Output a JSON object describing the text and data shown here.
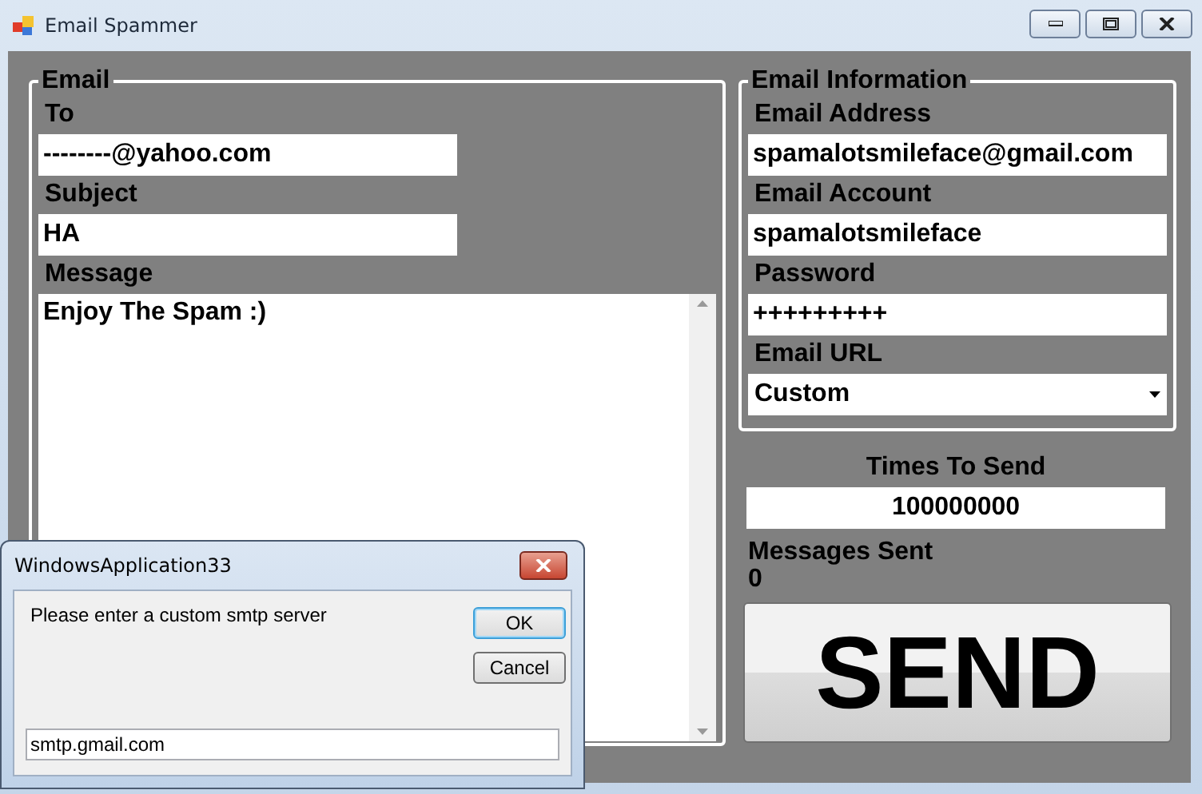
{
  "window": {
    "title": "Email Spammer"
  },
  "email_group": {
    "title": "Email",
    "fields": [
      {
        "label": "To",
        "value": "--------@yahoo.com"
      },
      {
        "label": "Subject",
        "value": "HA"
      }
    ],
    "message": {
      "label": "Message",
      "value": "Enjoy The Spam :)"
    }
  },
  "info_group": {
    "title": "Email Information",
    "fields": [
      {
        "label": "Email Address",
        "value": "spamalotsmileface@gmail.com",
        "kind": "text"
      },
      {
        "label": "Email Account",
        "value": "spamalotsmileface",
        "kind": "text"
      },
      {
        "label": "Password",
        "value": "+++++++++",
        "kind": "text"
      },
      {
        "label": "Email URL",
        "value": "Custom",
        "kind": "dropdown"
      }
    ]
  },
  "times_to_send": {
    "label": "Times To Send",
    "value": "100000000"
  },
  "messages_sent": {
    "label": "Messages Sent",
    "value": "0"
  },
  "send_button": "SEND",
  "dialog": {
    "title": "WindowsApplication33",
    "prompt": "Please enter a custom smtp server",
    "buttons": [
      {
        "label": "OK",
        "focused": true
      },
      {
        "label": "Cancel",
        "focused": false
      }
    ],
    "input": {
      "value": "smtp.gmail.com"
    }
  }
}
